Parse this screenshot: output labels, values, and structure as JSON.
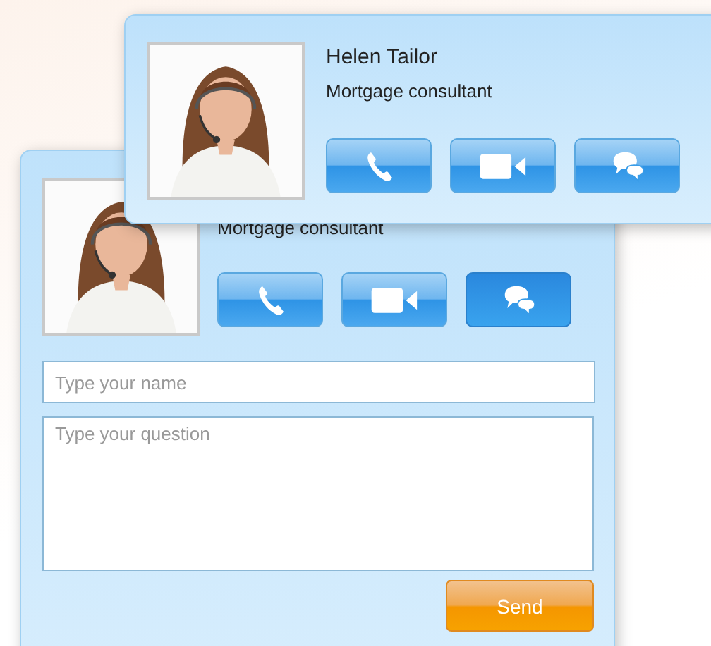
{
  "cards": [
    {
      "title": "Mortgage consultant",
      "buttons": [
        {
          "kind": "call",
          "selected": false
        },
        {
          "kind": "video",
          "selected": false
        },
        {
          "kind": "chat",
          "selected": true
        }
      ],
      "form": {
        "name_placeholder": "Type your name",
        "question_placeholder": "Type your question",
        "send": "Send"
      }
    },
    {
      "name": "Helen Tailor",
      "title": "Mortgage consultant",
      "buttons": [
        {
          "kind": "call",
          "selected": false
        },
        {
          "kind": "video",
          "selected": false
        },
        {
          "kind": "chat",
          "selected": false
        }
      ]
    }
  ]
}
